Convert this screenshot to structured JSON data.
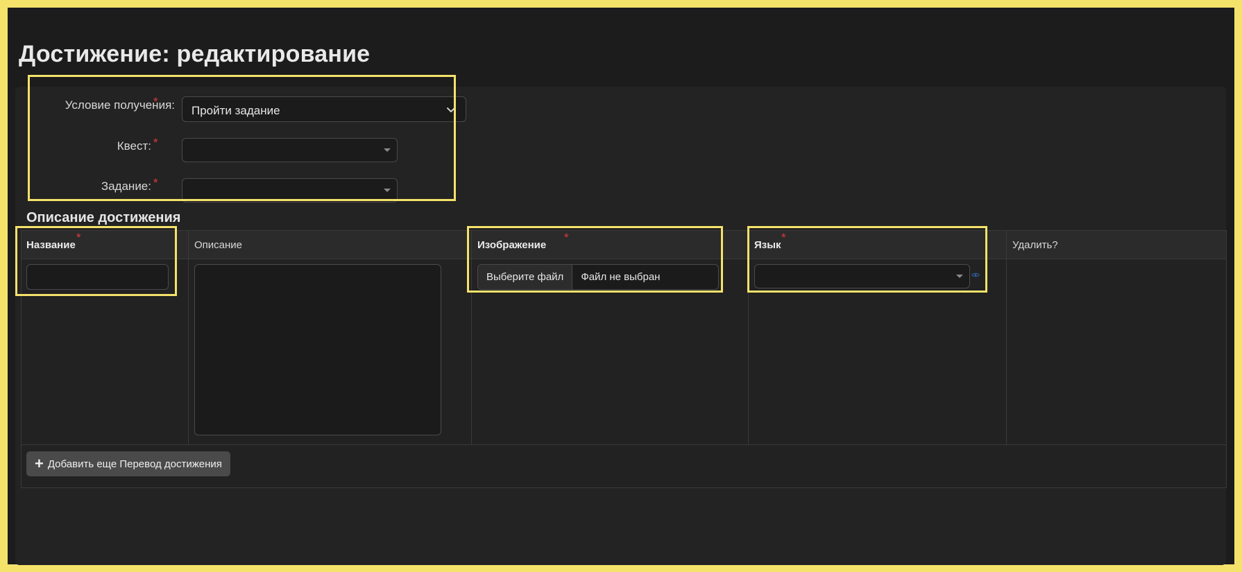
{
  "page": {
    "title": "Достижение: редактирование"
  },
  "form": {
    "condition": {
      "label": "Условие получения:",
      "value": "Пройти задание",
      "required_mark": "*"
    },
    "quest": {
      "label": "Квест:",
      "value": "",
      "required_mark": "*"
    },
    "task": {
      "label": "Задание:",
      "value": "",
      "required_mark": "*"
    }
  },
  "section": {
    "title": "Описание достижения"
  },
  "table": {
    "headers": {
      "name": "Название",
      "description": "Описание",
      "image": "Изображение",
      "language": "Язык",
      "delete": "Удалить?"
    },
    "required_mark": "*",
    "row": {
      "name": "",
      "description": "",
      "file_button": "Выберите файл",
      "file_status": "Файл не выбран",
      "language": ""
    },
    "add_button": "Добавить еще Перевод достижения"
  },
  "colors": {
    "highlight": "#f5e26b",
    "required": "#e0393e",
    "background": "#1c1c1c"
  },
  "icons": {
    "select_chevron": "chevron-down-icon",
    "select_caret": "caret-down-icon",
    "view": "eye-icon",
    "add": "plus-icon",
    "resize": "resize-grip-icon"
  }
}
